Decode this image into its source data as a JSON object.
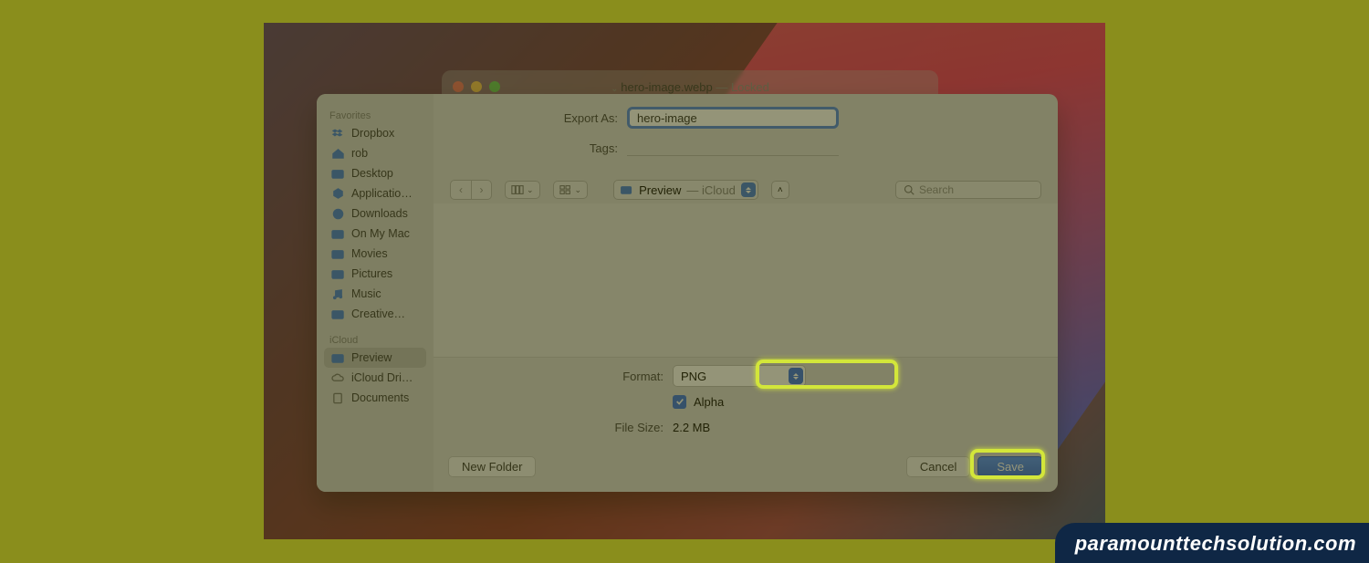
{
  "parent_window": {
    "title_name": "hero-image.webp",
    "title_sub": "— Locked"
  },
  "dialog": {
    "export_as_label": "Export As:",
    "export_as_value": "hero-image",
    "tags_label": "Tags:",
    "tags_value": "",
    "location": {
      "folder_name": "Preview",
      "location_suffix": "— iCloud"
    },
    "search_placeholder": "Search",
    "format_label": "Format:",
    "format_value": "PNG",
    "alpha_label": "Alpha",
    "alpha_checked": true,
    "filesize_label": "File Size:",
    "filesize_value": "2.2 MB",
    "new_folder_btn": "New Folder",
    "cancel_btn": "Cancel",
    "save_btn": "Save"
  },
  "sidebar": {
    "favorites_header": "Favorites",
    "favorites": [
      {
        "icon": "dropbox",
        "label": "Dropbox"
      },
      {
        "icon": "house",
        "label": "rob"
      },
      {
        "icon": "folder",
        "label": "Desktop"
      },
      {
        "icon": "app",
        "label": "Applicatio…"
      },
      {
        "icon": "download",
        "label": "Downloads"
      },
      {
        "icon": "folder",
        "label": "On My Mac"
      },
      {
        "icon": "folder",
        "label": "Movies"
      },
      {
        "icon": "folder",
        "label": "Pictures"
      },
      {
        "icon": "music",
        "label": "Music"
      },
      {
        "icon": "folder",
        "label": "Creative…"
      }
    ],
    "icloud_header": "iCloud",
    "icloud": [
      {
        "icon": "folder",
        "label": "Preview",
        "selected": true
      },
      {
        "icon": "cloud",
        "label": "iCloud Dri…"
      },
      {
        "icon": "doc",
        "label": "Documents"
      }
    ]
  },
  "watermark": "paramounttechsolution.com"
}
